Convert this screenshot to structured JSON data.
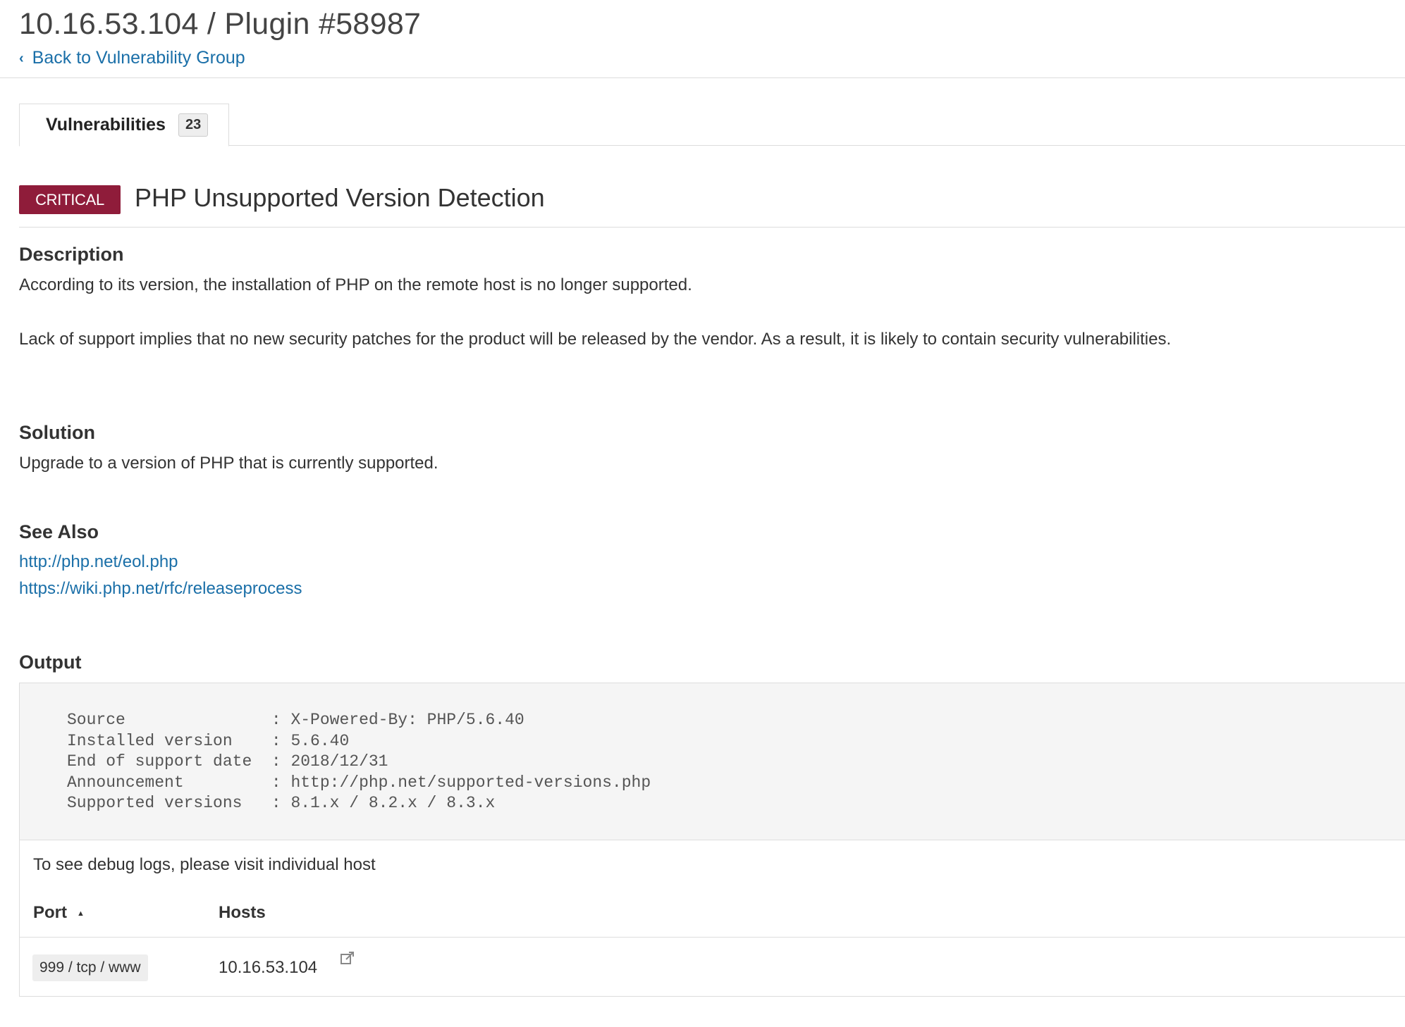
{
  "header": {
    "title": "10.16.53.104 / Plugin #58987",
    "back_link": "Back to Vulnerability Group",
    "back_icon": "chevron-left-icon"
  },
  "tabs": [
    {
      "label": "Vulnerabilities",
      "count": "23"
    }
  ],
  "vulnerability": {
    "severity": "CRITICAL",
    "severity_color": "#8f1c3a",
    "title": "PHP Unsupported Version Detection"
  },
  "description": {
    "heading": "Description",
    "paragraph1": "According to its version, the installation of PHP on the remote host is no longer supported.",
    "paragraph2": "Lack of support implies that no new security patches for the product will be released by the vendor. As a result, it is likely to contain security vulnerabilities."
  },
  "solution": {
    "heading": "Solution",
    "text": "Upgrade to a version of PHP that is currently supported."
  },
  "see_also": {
    "heading": "See Also",
    "links": [
      "http://php.net/eol.php",
      "https://wiki.php.net/rfc/releaseprocess"
    ]
  },
  "output": {
    "heading": "Output",
    "text": "Source               : X-Powered-By: PHP/5.6.40\nInstalled version    : 5.6.40\nEnd of support date  : 2018/12/31\nAnnouncement         : http://php.net/supported-versions.php\nSupported versions   : 8.1.x / 8.2.x / 8.3.x",
    "debug_note": "To see debug logs, please visit individual host",
    "columns": {
      "port": "Port",
      "hosts": "Hosts"
    },
    "sort_icon": "sort-ascending-icon",
    "rows": [
      {
        "port": "999 / tcp / www",
        "host": "10.16.53.104",
        "link_icon": "external-link-icon"
      }
    ]
  },
  "colors": {
    "link": "#1a6fa8",
    "critical": "#8f1c3a",
    "border": "#dddddd",
    "output_bg": "#f5f5f5"
  }
}
